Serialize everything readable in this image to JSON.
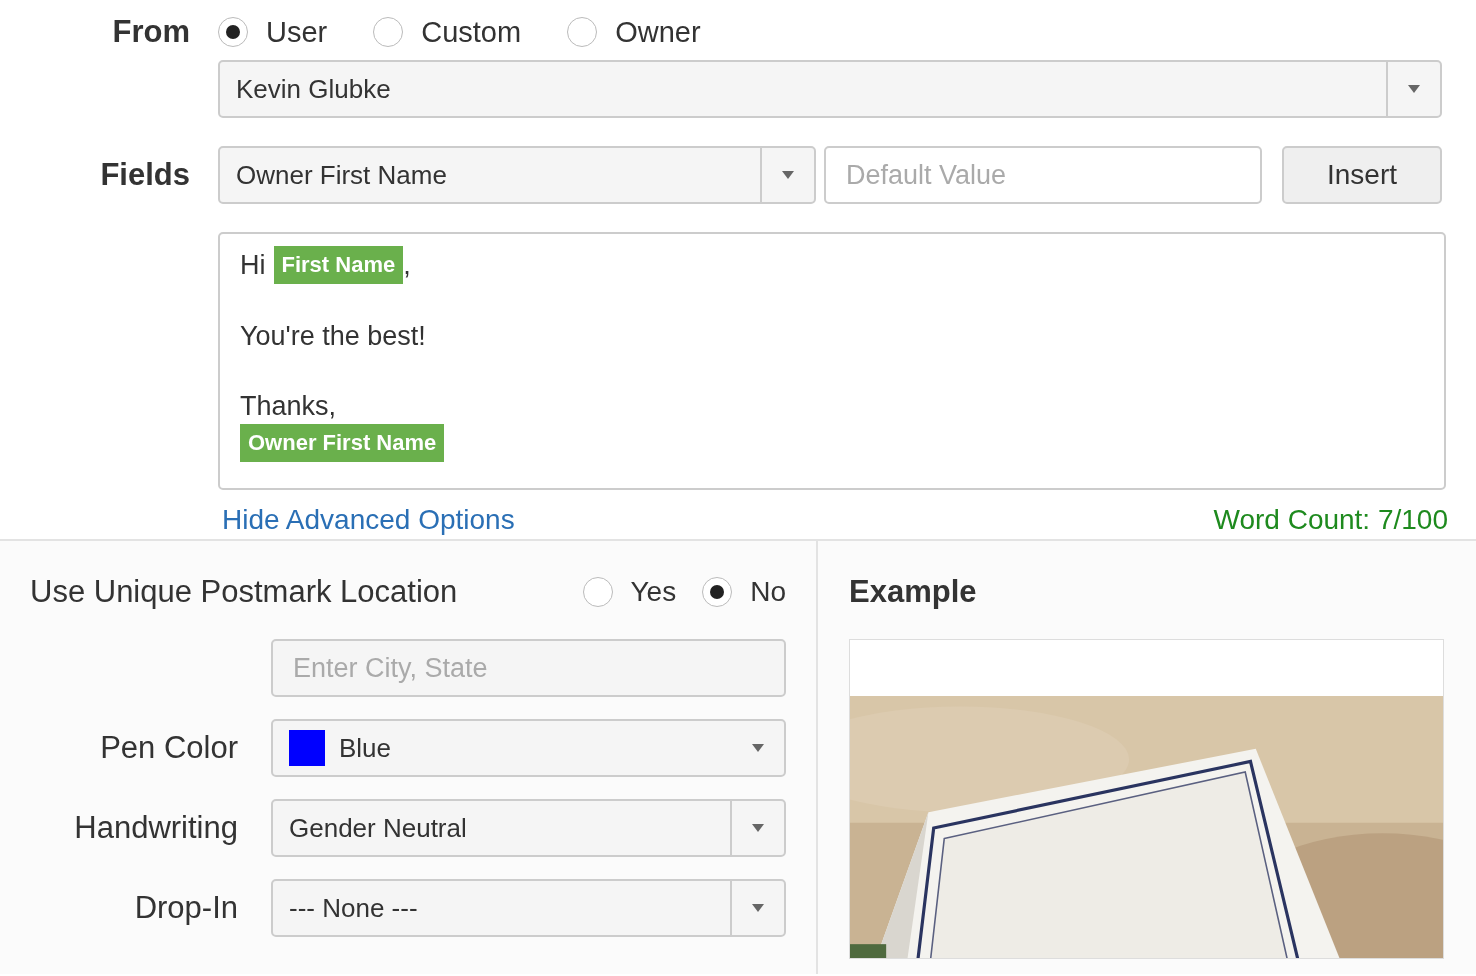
{
  "from": {
    "label": "From",
    "options": [
      {
        "label": "User",
        "selected": true
      },
      {
        "label": "Custom",
        "selected": false
      },
      {
        "label": "Owner",
        "selected": false
      }
    ],
    "user_select": {
      "value": "Kevin Glubke"
    }
  },
  "fields": {
    "label": "Fields",
    "field_select": {
      "value": "Owner First Name"
    },
    "default_value": {
      "placeholder": "Default Value"
    },
    "insert_button": "Insert"
  },
  "message": {
    "paragraphs": [
      {
        "lines": [
          [
            {
              "kind": "text",
              "text": "Hi"
            },
            {
              "kind": "tag",
              "text": "First Name"
            },
            {
              "kind": "text",
              "text": ","
            }
          ]
        ]
      },
      {
        "lines": [
          [
            {
              "kind": "text",
              "text": "You're the best!"
            }
          ]
        ]
      },
      {
        "lines": [
          [
            {
              "kind": "text",
              "text": "Thanks,"
            }
          ],
          [
            {
              "kind": "tag",
              "text": "Owner First Name"
            }
          ]
        ]
      }
    ]
  },
  "advanced_link": "Hide Advanced Options",
  "word_count": "Word Count: 7/100",
  "postmark": {
    "label": "Use Unique Postmark Location",
    "options": [
      {
        "label": "Yes",
        "selected": false
      },
      {
        "label": "No",
        "selected": true
      }
    ],
    "location": {
      "placeholder": "Enter City, State"
    }
  },
  "pen_color": {
    "label": "Pen Color",
    "value": "Blue",
    "color": "#0000ff"
  },
  "handwriting": {
    "label": "Handwriting",
    "value": "Gender Neutral"
  },
  "drop_in": {
    "label": "Drop-In",
    "value": "--- None ---"
  },
  "example": {
    "title": "Example"
  }
}
